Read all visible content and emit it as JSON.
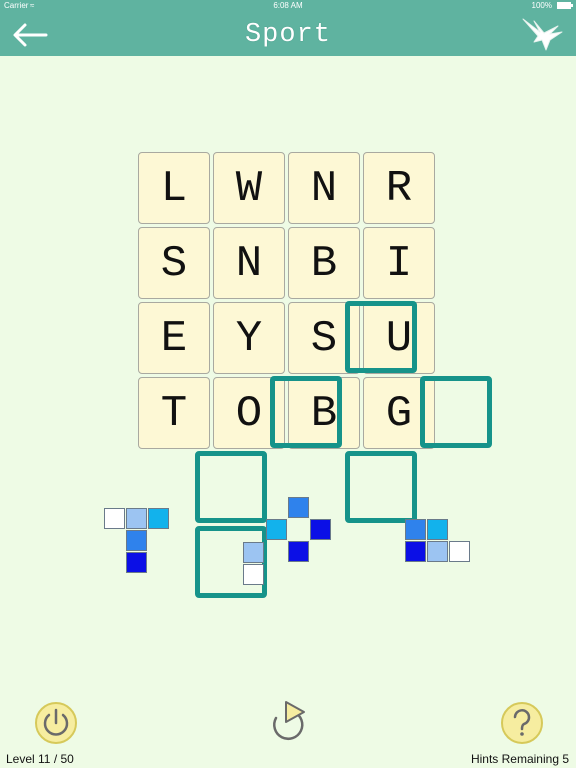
{
  "status_bar": {
    "carrier": "Carrier",
    "time": "6:08 AM",
    "battery": "100%"
  },
  "header": {
    "title": "Sport",
    "back_icon": "arrow-left-icon",
    "logo_icon": "bird-icon"
  },
  "board": {
    "rows": [
      [
        "L",
        "W",
        "N",
        "R"
      ],
      [
        "S",
        "N",
        "B",
        "I"
      ],
      [
        "E",
        "Y",
        "S",
        "U"
      ],
      [
        "T",
        "O",
        "B",
        "G"
      ]
    ]
  },
  "piece_colors": {
    "white": "#ffffff",
    "light_blue": "#9cc4f2",
    "cyan": "#12b2ec",
    "mid_blue": "#2f82ec",
    "deep_blue": "#0b0fe6",
    "frame": "#16938a"
  },
  "footer": {
    "level_text": "Level 11 / 50",
    "hints_text": "Hints Remaining 5",
    "power_icon": "power-icon",
    "restart_icon": "restart-icon",
    "help_icon": "help-icon"
  }
}
